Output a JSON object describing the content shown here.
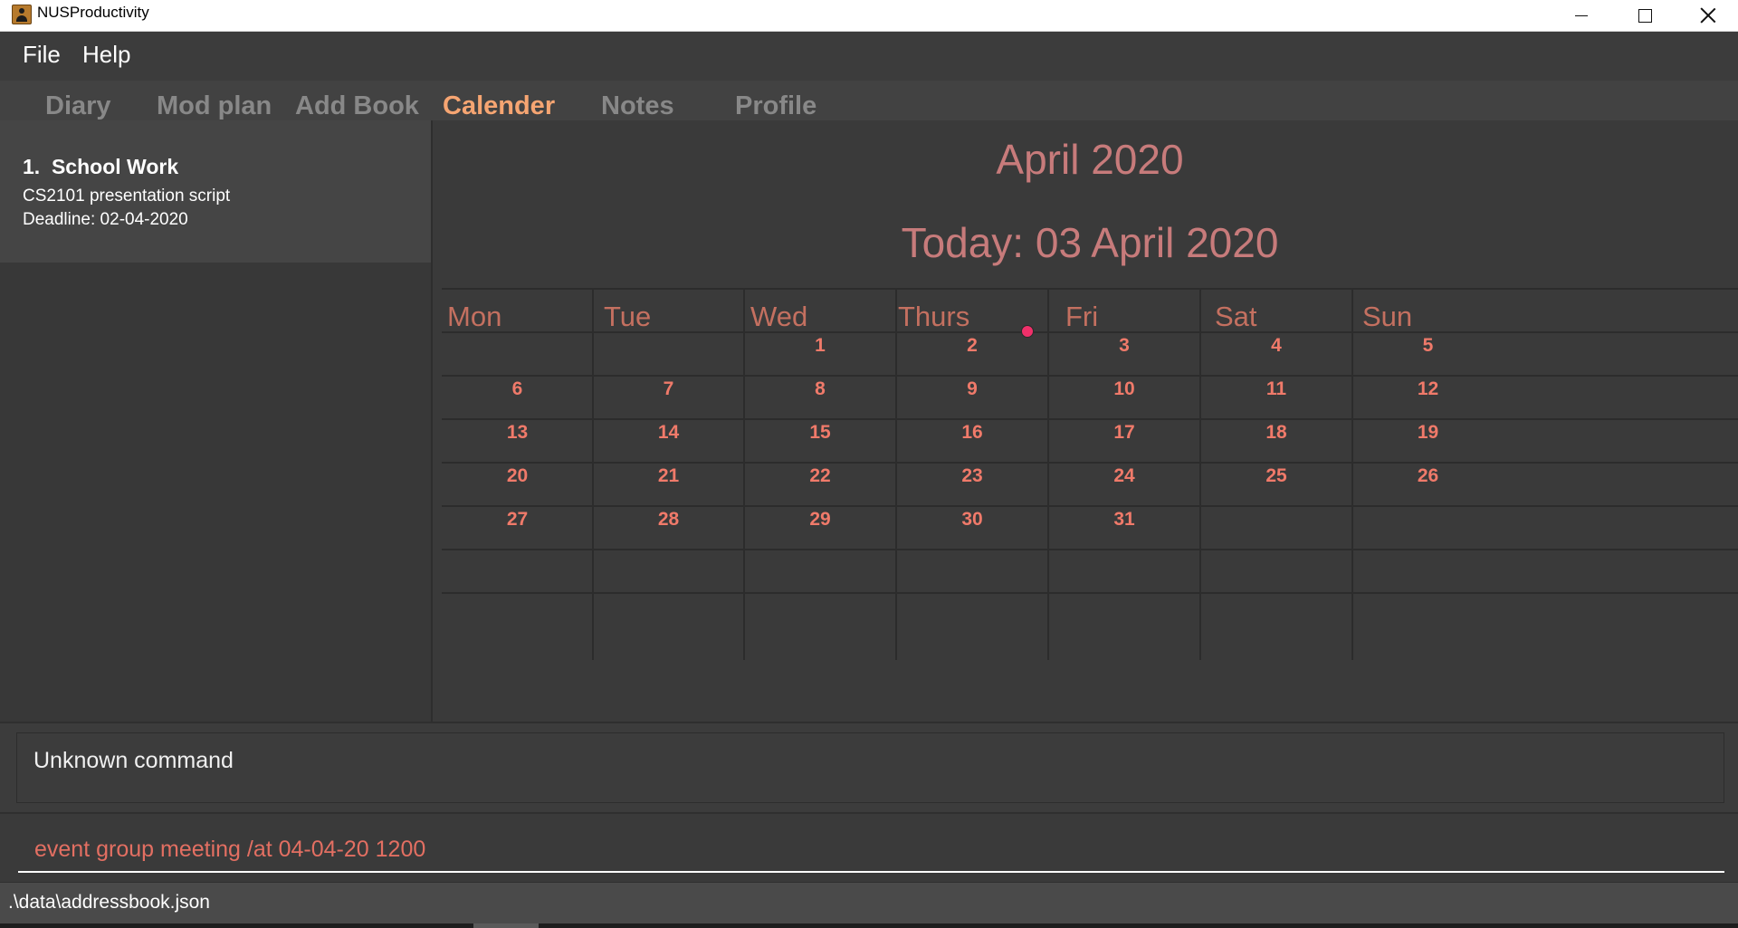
{
  "window": {
    "title": "NUSProductivity",
    "app_icon": "person-badge-icon",
    "controls": [
      "minimize-icon",
      "maximize-icon",
      "close-icon"
    ]
  },
  "menu": {
    "file": "File",
    "help": "Help"
  },
  "tabs": [
    {
      "label": "Diary",
      "active": false
    },
    {
      "label": "Mod plan",
      "active": false
    },
    {
      "label": "Add Book",
      "active": false
    },
    {
      "label": "Calender",
      "active": true
    },
    {
      "label": "Notes",
      "active": false
    },
    {
      "label": "Profile",
      "active": false
    }
  ],
  "task_list": [
    {
      "index": "1.",
      "title": "School Work",
      "description": "CS2101 presentation script",
      "deadline": "Deadline: 02-04-2020"
    }
  ],
  "calendar": {
    "month_title": "April 2020",
    "today_label": "Today: 03 April 2020",
    "day_names": [
      "Mon",
      "Tue",
      "Wed",
      "Thurs",
      "Fri",
      "Sat",
      "Sun"
    ],
    "weeks": [
      [
        "",
        "",
        "1",
        "2",
        "3",
        "4",
        "5"
      ],
      [
        "6",
        "7",
        "8",
        "9",
        "10",
        "11",
        "12"
      ],
      [
        "13",
        "14",
        "15",
        "16",
        "17",
        "18",
        "19"
      ],
      [
        "20",
        "21",
        "22",
        "23",
        "24",
        "25",
        "26"
      ],
      [
        "27",
        "28",
        "29",
        "30",
        "31",
        "",
        ""
      ],
      [
        "",
        "",
        "",
        "",
        "",
        "",
        ""
      ]
    ],
    "event_marker_date": "2"
  },
  "result": {
    "text": "Unknown command"
  },
  "command": {
    "value": "event group meeting /at 04-04-20 1200"
  },
  "status": {
    "path": ".\\data\\addressbook.json"
  },
  "colors": {
    "background": "#3c3c3c",
    "active_tab": "#f6a572",
    "inactive_tab": "#888888",
    "calendar_heading": "#c77b7b",
    "day_name": "#c47060",
    "date_number": "#f07a6a",
    "event_dot": "#f0306a",
    "command_text": "#e36f62"
  }
}
